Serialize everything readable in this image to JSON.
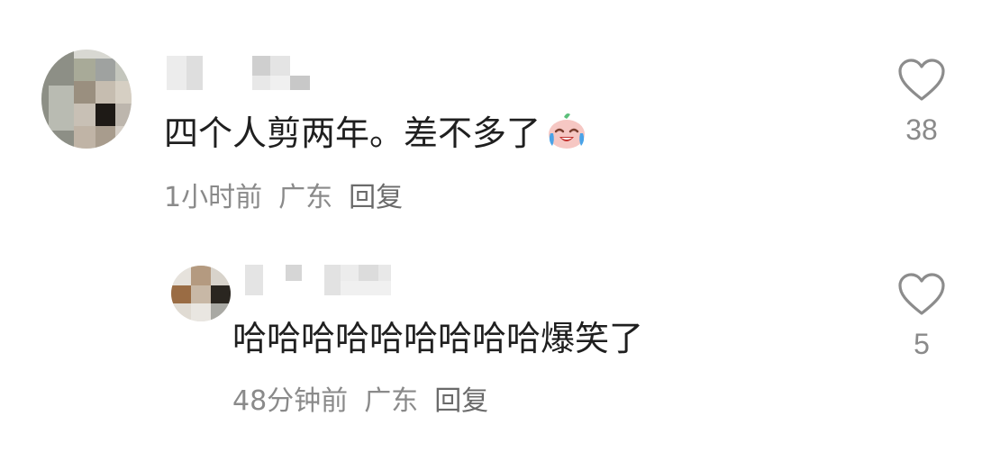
{
  "comments": [
    {
      "text": "四个人剪两年。差不多了",
      "emoji_icon": "crying-laughing-icon",
      "time": "1小时前",
      "location": "广东",
      "reply_label": "回复",
      "like_count": "38",
      "like_icon": "heart-outline-icon"
    }
  ],
  "replies": [
    {
      "text": "哈哈哈哈哈哈哈哈哈爆笑了",
      "time": "48分钟前",
      "location": "广东",
      "reply_label": "回复",
      "like_count": "5",
      "like_icon": "heart-outline-icon"
    }
  ]
}
